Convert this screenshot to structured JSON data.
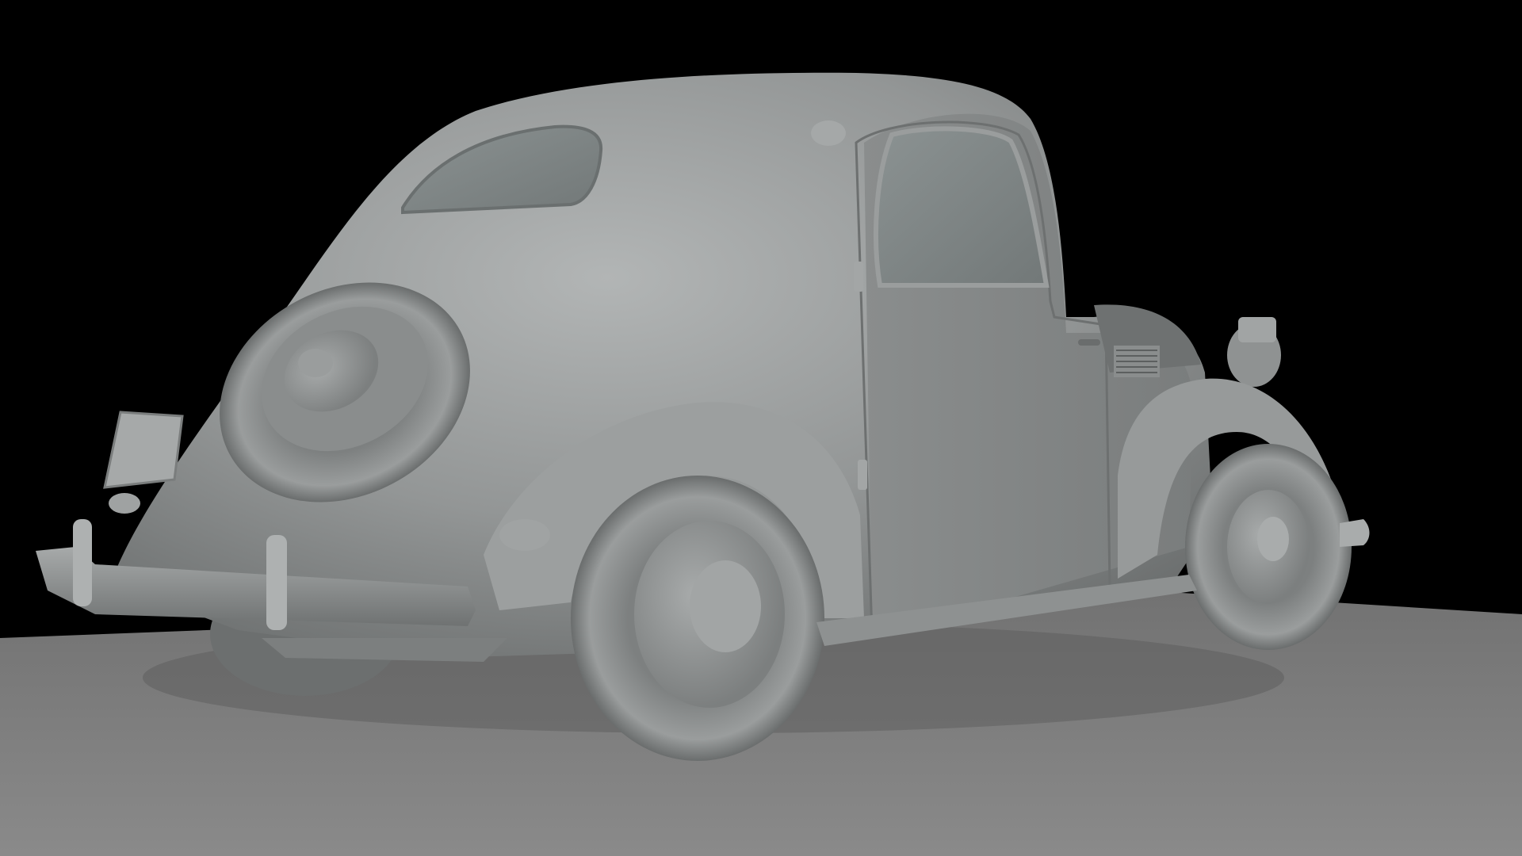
{
  "scene": {
    "subject": "car-model-render",
    "render_style": "clay-shaded",
    "colors": {
      "background": "#000000",
      "ground_plane": "#7c7c7c",
      "car_body": "#8d9090",
      "car_highlight": "#b4b7b7",
      "car_shadow": "#5a5d5d",
      "window_glass": "#7f8686"
    }
  }
}
